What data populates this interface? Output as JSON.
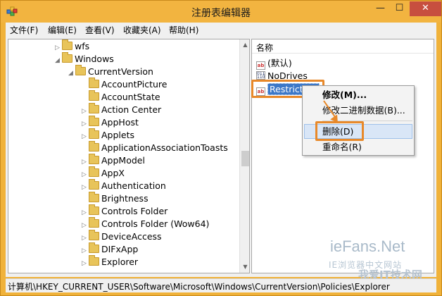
{
  "window": {
    "title": "注册表编辑器",
    "min": "—",
    "max": "☐",
    "close": "✕"
  },
  "menu": {
    "items": [
      "文件(F)",
      "编辑(E)",
      "查看(V)",
      "收藏夹(A)",
      "帮助(H)"
    ]
  },
  "tree": {
    "items": [
      {
        "label": "wfs",
        "arrow": "▷"
      },
      {
        "label": "Windows",
        "arrow": "◢"
      },
      {
        "label": "CurrentVersion",
        "arrow": "◢"
      },
      {
        "label": "AccountPicture",
        "arrow": ""
      },
      {
        "label": "AccountState",
        "arrow": ""
      },
      {
        "label": "Action Center",
        "arrow": "▷"
      },
      {
        "label": "AppHost",
        "arrow": "▷"
      },
      {
        "label": "Applets",
        "arrow": "▷"
      },
      {
        "label": "ApplicationAssociationToasts",
        "arrow": ""
      },
      {
        "label": "AppModel",
        "arrow": "▷"
      },
      {
        "label": "AppX",
        "arrow": "▷"
      },
      {
        "label": "Authentication",
        "arrow": "▷"
      },
      {
        "label": "Brightness",
        "arrow": ""
      },
      {
        "label": "Controls Folder",
        "arrow": "▷"
      },
      {
        "label": "Controls Folder (Wow64)",
        "arrow": "▷"
      },
      {
        "label": "DeviceAccess",
        "arrow": "▷"
      },
      {
        "label": "DIFxApp",
        "arrow": "▷"
      },
      {
        "label": "Explorer",
        "arrow": "▷"
      }
    ]
  },
  "values": {
    "header": "名称",
    "rows": [
      {
        "name": "(默认)",
        "icon": "ab"
      },
      {
        "name": "NoDrives",
        "icon": "bin"
      },
      {
        "name": "Restrict",
        "icon": "ab"
      }
    ]
  },
  "context_menu": {
    "items": [
      "修改(M)...",
      "修改二进制数据(B)...",
      "删除(D)",
      "重命名(R)"
    ]
  },
  "status": {
    "path": "计算机\\HKEY_CURRENT_USER\\Software\\Microsoft\\Windows\\CurrentVersion\\Policies\\Explorer"
  },
  "watermark": {
    "line1": "ieFans.Net",
    "line2": "IE浏览器中文网站",
    "line3": "我爱IT技术网"
  },
  "colors": {
    "title_bar": "#f2b440",
    "close_button": "#c74f3f",
    "highlight": "#e8892a",
    "selection": "#3c78c8"
  }
}
